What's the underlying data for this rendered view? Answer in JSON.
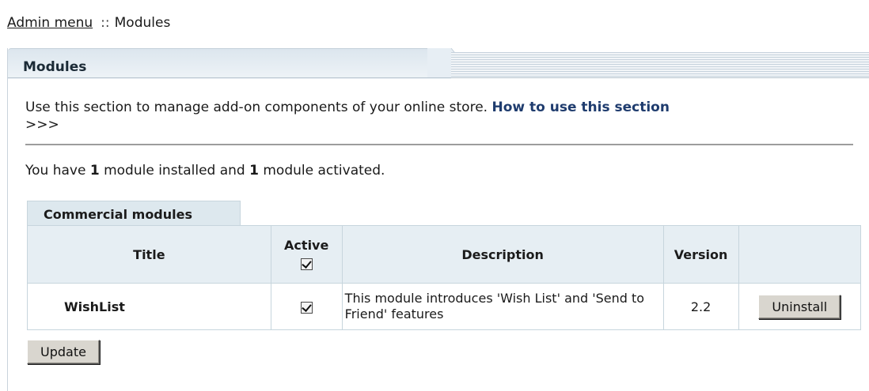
{
  "breadcrumb": {
    "root": "Admin menu",
    "separator": "::",
    "current": "Modules"
  },
  "panel": {
    "title": "Modules",
    "intro_text": "Use this section to manage add-on components of your online store.",
    "help_link": "How to use this section",
    "help_arrow": ">>>"
  },
  "summary": {
    "prefix": "You have",
    "installed_count": "1",
    "installed_text": "module installed and",
    "activated_count": "1",
    "activated_text": "module activated."
  },
  "section_tab": "Commercial modules",
  "table": {
    "headers": {
      "title": "Title",
      "active": "Active",
      "description": "Description",
      "version": "Version"
    },
    "header_active_checked": true,
    "rows": [
      {
        "title": "WishList",
        "active": true,
        "description": "This module introduces 'Wish List' and 'Send to Friend' features",
        "version": "2.2",
        "action": "Uninstall"
      }
    ]
  },
  "buttons": {
    "update": "Update"
  },
  "colors": {
    "link": "#1f3c6e",
    "header_bg": "#e6eef3",
    "border": "#c7d5dd"
  }
}
